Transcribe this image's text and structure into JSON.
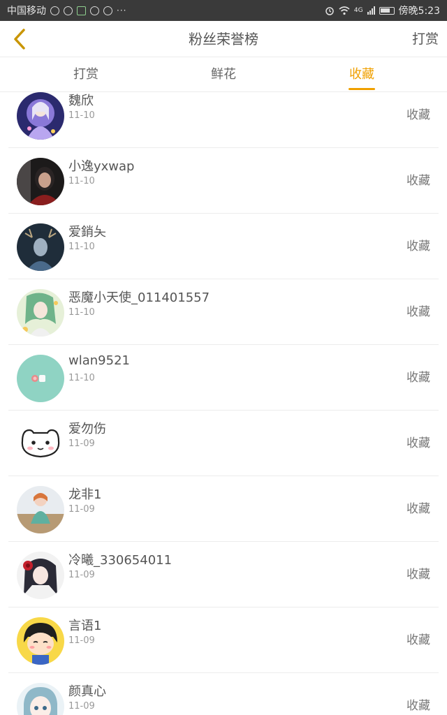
{
  "status_bar": {
    "carrier": "中国移动",
    "time": "傍晚5:23",
    "network": "4G",
    "more": "···"
  },
  "header": {
    "title": "粉丝荣誉榜",
    "action": "打赏"
  },
  "tabs": [
    {
      "label": "打赏",
      "active": false
    },
    {
      "label": "鲜花",
      "active": false
    },
    {
      "label": "收藏",
      "active": true
    }
  ],
  "colors": {
    "accent": "#f0a000",
    "status_bar_bg": "#3a3a3a",
    "divider": "#ececec"
  },
  "fans": [
    {
      "name": "魏欣",
      "date": "11-10",
      "action": "收藏",
      "avatar": "anime-girl-purple"
    },
    {
      "name": "小逸yxwap",
      "date": "11-10",
      "action": "收藏",
      "avatar": "photo-dark-red"
    },
    {
      "name": "爱銷夨",
      "date": "11-10",
      "action": "收藏",
      "avatar": "photo-deer-antlers"
    },
    {
      "name": "恶魔小天使_011401557",
      "date": "11-10",
      "action": "收藏",
      "avatar": "anime-green-hair"
    },
    {
      "name": "wlan9521",
      "date": "11-10",
      "action": "收藏",
      "avatar": "mint-cups"
    },
    {
      "name": "爱勿伤",
      "date": "11-09",
      "action": "收藏",
      "avatar": "cartoon-cat-face"
    },
    {
      "name": "龙非1",
      "date": "11-09",
      "action": "收藏",
      "avatar": "doll-on-beach"
    },
    {
      "name": "冷曦_330654011",
      "date": "11-09",
      "action": "收藏",
      "avatar": "anime-red-flower"
    },
    {
      "name": "言语1",
      "date": "11-09",
      "action": "收藏",
      "avatar": "cartoon-maruko"
    },
    {
      "name": "颜真心",
      "date": "11-09",
      "action": "收藏",
      "avatar": "anime-teal-hair"
    }
  ]
}
